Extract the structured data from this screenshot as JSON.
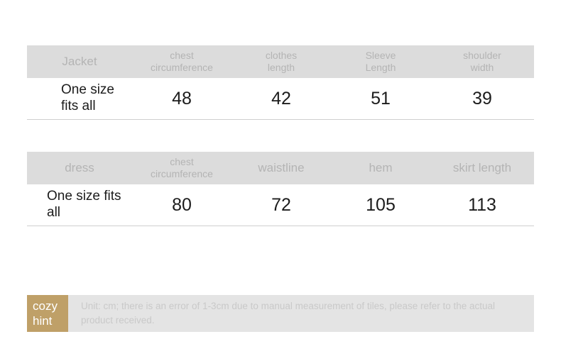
{
  "tables": [
    {
      "id": "jacket",
      "headers": [
        "Jacket",
        "chest\ncircumference",
        "clothes\nlength",
        "Sleeve\nLength",
        "shoulder\nwidth"
      ],
      "rows": [
        [
          "One size fits all",
          "48",
          "42",
          "51",
          "39"
        ]
      ]
    },
    {
      "id": "dress",
      "headers": [
        "dress",
        "chest\ncircumference",
        "waistline",
        "hem",
        "skirt length"
      ],
      "rows": [
        [
          "One size fits all",
          "80",
          "72",
          "105",
          "113"
        ]
      ]
    }
  ],
  "jacket": {
    "header": {
      "c0": "Jacket",
      "c1_line1": "chest",
      "c1_line2": "circumference",
      "c2_line1": "clothes",
      "c2_line2": "length",
      "c3_line1": "Sleeve",
      "c3_line2": "Length",
      "c4_line1": "shoulder",
      "c4_line2": "width"
    },
    "row": {
      "c0": "One size fits all",
      "c1": "48",
      "c2": "42",
      "c3": "51",
      "c4": "39"
    }
  },
  "dress": {
    "header": {
      "c0": "dress",
      "c1_line1": "chest",
      "c1_line2": "circumference",
      "c2": "waistline",
      "c3": "hem",
      "c4": "skirt length"
    },
    "row": {
      "c0": "One size fits all",
      "c1": "80",
      "c2": "72",
      "c3": "105",
      "c4": "113"
    }
  },
  "hint": {
    "badge_line1": "cozy",
    "badge_line2": "hint",
    "text": "Unit: cm; there is an error of 1-3cm due to manual measurement of tiles, please refer to the actual product received."
  },
  "colors": {
    "header_band": "#dcdcdc",
    "header_text": "#b4b4b4",
    "data_text": "#1c1c1c",
    "row_border": "#cfcfcf",
    "hint_band": "#e4e4e4",
    "hint_badge": "#bfa068",
    "hint_text": "#c9c9c9",
    "background": "#ffffff"
  }
}
